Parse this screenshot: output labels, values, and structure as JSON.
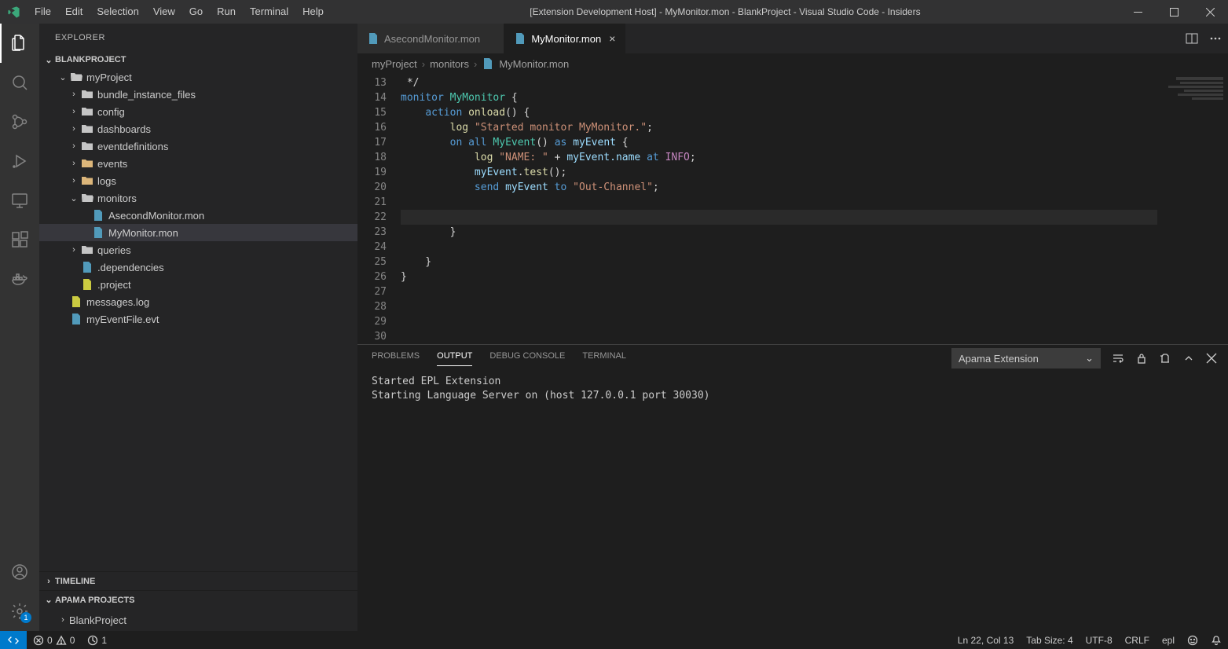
{
  "title": "[Extension Development Host] - MyMonitor.mon - BlankProject - Visual Studio Code - Insiders",
  "menu": [
    "File",
    "Edit",
    "Selection",
    "View",
    "Go",
    "Run",
    "Terminal",
    "Help"
  ],
  "sidebar": {
    "title": "EXPLORER",
    "project": "BLANKPROJECT",
    "timeline": "TIMELINE",
    "apama_header": "APAMA PROJECTS",
    "apama_item": "BlankProject"
  },
  "tree": [
    {
      "indent": 0,
      "open": true,
      "type": "folder-open",
      "label": "myProject"
    },
    {
      "indent": 1,
      "open": false,
      "type": "folder",
      "label": "bundle_instance_files"
    },
    {
      "indent": 1,
      "open": false,
      "type": "folder",
      "label": "config"
    },
    {
      "indent": 1,
      "open": false,
      "type": "folder",
      "label": "dashboards"
    },
    {
      "indent": 1,
      "open": false,
      "type": "folder",
      "label": "eventdefinitions"
    },
    {
      "indent": 1,
      "open": false,
      "type": "folder-yellow",
      "label": "events"
    },
    {
      "indent": 1,
      "open": false,
      "type": "folder-yellow",
      "label": "logs"
    },
    {
      "indent": 1,
      "open": true,
      "type": "folder-open",
      "label": "monitors"
    },
    {
      "indent": 2,
      "type": "file-blue",
      "label": "AsecondMonitor.mon"
    },
    {
      "indent": 2,
      "type": "file-blue",
      "label": "MyMonitor.mon",
      "selected": true
    },
    {
      "indent": 1,
      "open": false,
      "type": "folder",
      "label": "queries"
    },
    {
      "indent": 1,
      "type": "file-blue",
      "label": ".dependencies"
    },
    {
      "indent": 1,
      "type": "file-yellow",
      "label": ".project"
    },
    {
      "indent": 0,
      "type": "file-yellow",
      "label": "messages.log"
    },
    {
      "indent": 0,
      "type": "file-blue",
      "label": "myEventFile.evt"
    }
  ],
  "tabs": [
    {
      "label": "AsecondMonitor.mon",
      "active": false
    },
    {
      "label": "MyMonitor.mon",
      "active": true
    }
  ],
  "breadcrumb": [
    "myProject",
    "monitors",
    "MyMonitor.mon"
  ],
  "code": {
    "startLine": 13,
    "lines": [
      {
        "tokens": [
          {
            "t": " */",
            "c": "pun"
          }
        ]
      },
      {
        "tokens": [
          {
            "t": "monitor ",
            "c": "kw"
          },
          {
            "t": "MyMonitor",
            "c": "type"
          },
          {
            "t": " {",
            "c": "pun"
          }
        ]
      },
      {
        "tokens": [
          {
            "t": "    ",
            "c": "pun"
          },
          {
            "t": "action ",
            "c": "kw"
          },
          {
            "t": "onload",
            "c": "fn"
          },
          {
            "t": "() {",
            "c": "pun"
          }
        ]
      },
      {
        "tokens": [
          {
            "t": "        ",
            "c": "pun"
          },
          {
            "t": "log ",
            "c": "fn"
          },
          {
            "t": "\"Started monitor MyMonitor.\"",
            "c": "str"
          },
          {
            "t": ";",
            "c": "pun"
          }
        ]
      },
      {
        "tokens": [
          {
            "t": "        ",
            "c": "pun"
          },
          {
            "t": "on all ",
            "c": "kw"
          },
          {
            "t": "MyEvent",
            "c": "type"
          },
          {
            "t": "() ",
            "c": "pun"
          },
          {
            "t": "as ",
            "c": "kw"
          },
          {
            "t": "myEvent",
            "c": "var"
          },
          {
            "t": " {",
            "c": "pun"
          }
        ]
      },
      {
        "tokens": [
          {
            "t": "            ",
            "c": "pun"
          },
          {
            "t": "log ",
            "c": "fn"
          },
          {
            "t": "\"NAME: \"",
            "c": "str"
          },
          {
            "t": " + ",
            "c": "pun"
          },
          {
            "t": "myEvent.name",
            "c": "var"
          },
          {
            "t": " at ",
            "c": "kw"
          },
          {
            "t": "INFO",
            "c": "info"
          },
          {
            "t": ";",
            "c": "pun"
          }
        ]
      },
      {
        "tokens": [
          {
            "t": "            ",
            "c": "pun"
          },
          {
            "t": "myEvent",
            "c": "var"
          },
          {
            "t": ".",
            "c": "pun"
          },
          {
            "t": "test",
            "c": "fn"
          },
          {
            "t": "();",
            "c": "pun"
          }
        ]
      },
      {
        "tokens": [
          {
            "t": "            ",
            "c": "pun"
          },
          {
            "t": "send ",
            "c": "kw"
          },
          {
            "t": "myEvent",
            "c": "var"
          },
          {
            "t": " to ",
            "c": "kw"
          },
          {
            "t": "\"Out-Channel\"",
            "c": "str"
          },
          {
            "t": ";",
            "c": "pun"
          }
        ]
      },
      {
        "tokens": [
          {
            "t": "",
            "c": "pun"
          }
        ]
      },
      {
        "tokens": [
          {
            "t": "",
            "c": "pun"
          }
        ],
        "current": true
      },
      {
        "tokens": [
          {
            "t": "        }",
            "c": "pun"
          }
        ]
      },
      {
        "tokens": [
          {
            "t": "",
            "c": "pun"
          }
        ]
      },
      {
        "tokens": [
          {
            "t": "    }",
            "c": "pun"
          }
        ]
      },
      {
        "tokens": [
          {
            "t": "}",
            "c": "pun"
          }
        ]
      },
      {
        "tokens": [
          {
            "t": "",
            "c": "pun"
          }
        ]
      },
      {
        "tokens": [
          {
            "t": "",
            "c": "pun"
          }
        ]
      },
      {
        "tokens": [
          {
            "t": "",
            "c": "pun"
          }
        ]
      },
      {
        "tokens": [
          {
            "t": "",
            "c": "pun"
          }
        ]
      }
    ]
  },
  "panel": {
    "tabs": [
      "PROBLEMS",
      "OUTPUT",
      "DEBUG CONSOLE",
      "TERMINAL"
    ],
    "active": 1,
    "select": "Apama Extension",
    "lines": [
      "Started EPL Extension",
      "Starting Language Server on (host 127.0.0.1 port 30030)"
    ]
  },
  "status": {
    "errors": "0",
    "warnings": "0",
    "ports": "1",
    "cursor": "Ln 22, Col 13",
    "tabsize": "Tab Size: 4",
    "encoding": "UTF-8",
    "eol": "CRLF",
    "lang": "epl"
  },
  "settings_badge": "1"
}
